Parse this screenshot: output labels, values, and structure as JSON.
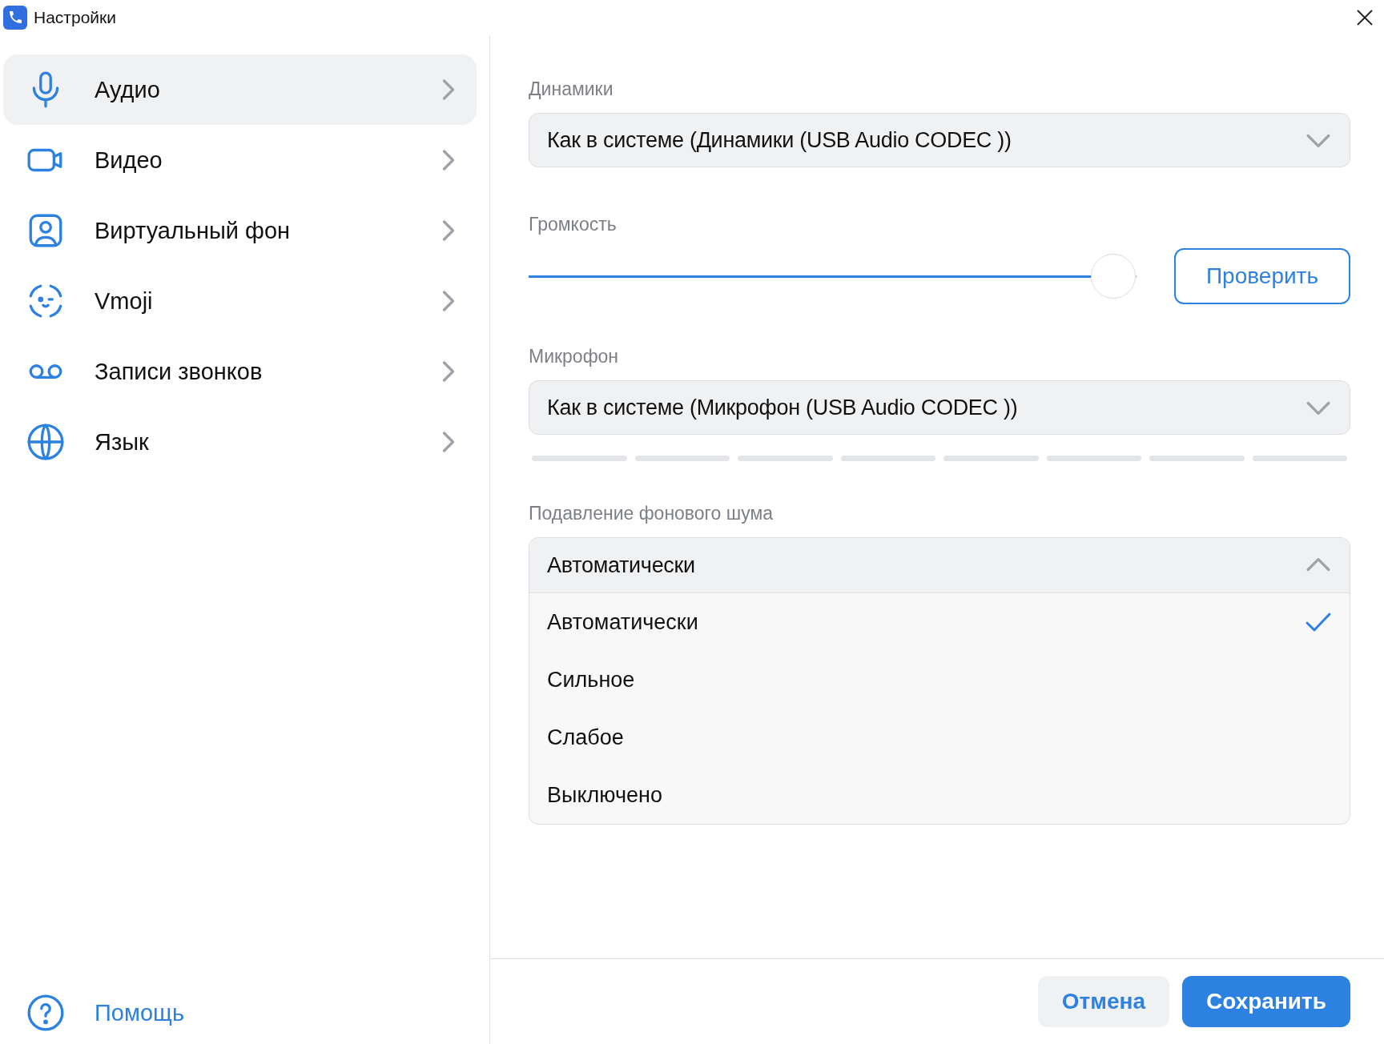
{
  "window": {
    "title": "Настройки"
  },
  "sidebar": {
    "items": [
      {
        "label": "Аудио",
        "selected": true
      },
      {
        "label": "Видео",
        "selected": false
      },
      {
        "label": "Виртуальный фон",
        "selected": false
      },
      {
        "label": "Vmoji",
        "selected": false
      },
      {
        "label": "Записи звонков",
        "selected": false
      },
      {
        "label": "Язык",
        "selected": false
      }
    ],
    "help": "Помощь"
  },
  "speakers": {
    "label": "Динамики",
    "value": "Как в системе (Динамики (USB Audio CODEC ))"
  },
  "volume": {
    "label": "Громкость",
    "level": 0.96,
    "button": "Проверить"
  },
  "microphone": {
    "label": "Микрофон",
    "value": "Как в системе (Микрофон (USB Audio CODEC ))"
  },
  "noise": {
    "label": "Подавление фонового шума",
    "value": "Автоматически",
    "expanded": true,
    "options": [
      {
        "label": "Автоматически",
        "selected": true
      },
      {
        "label": "Сильное",
        "selected": false
      },
      {
        "label": "Слабое",
        "selected": false
      },
      {
        "label": "Выключено",
        "selected": false
      }
    ]
  },
  "footer": {
    "cancel": "Отмена",
    "save": "Сохранить"
  }
}
